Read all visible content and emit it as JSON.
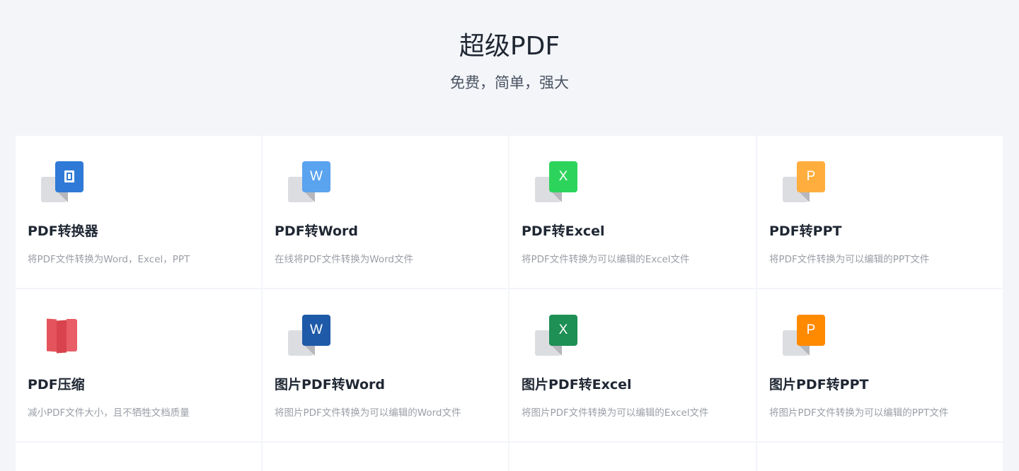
{
  "header": {
    "title": "超级PDF",
    "subtitle": "免费，简单，强大"
  },
  "colors": {
    "background": "#f3f5f9",
    "card": "#ffffff",
    "converter": "#2f7ad6",
    "word": "#5aa3ef",
    "excel": "#2dd45c",
    "ppt": "#ffae3d",
    "compress": "#e3525b",
    "word_image": "#1e5aa8",
    "excel_image": "#1e8f55",
    "ppt_image": "#ff8a00"
  },
  "cards": [
    {
      "icon": "office-icon",
      "icon_letter": "",
      "title": "PDF转换器",
      "description": "将PDF文件转换为Word，Excel，PPT"
    },
    {
      "icon": "word-icon",
      "icon_letter": "W",
      "title": "PDF转Word",
      "description": "在线将PDF文件转换为Word文件"
    },
    {
      "icon": "excel-icon",
      "icon_letter": "X",
      "title": "PDF转Excel",
      "description": "将PDF文件转换为可以编辑的Excel文件"
    },
    {
      "icon": "ppt-icon",
      "icon_letter": "P",
      "title": "PDF转PPT",
      "description": "将PDF文件转换为可以编辑的PPT文件"
    },
    {
      "icon": "compress-icon",
      "icon_letter": "",
      "title": "PDF压缩",
      "description": "减小PDF文件大小，且不牺牲文档质量"
    },
    {
      "icon": "word-icon",
      "icon_letter": "W",
      "title": "图片PDF转Word",
      "description": "将图片PDF文件转换为可以编辑的Word文件"
    },
    {
      "icon": "excel-icon",
      "icon_letter": "X",
      "title": "图片PDF转Excel",
      "description": "将图片PDF文件转换为可以编辑的Excel文件"
    },
    {
      "icon": "ppt-icon",
      "icon_letter": "P",
      "title": "图片PDF转PPT",
      "description": "将图片PDF文件转换为可以编辑的PPT文件"
    }
  ]
}
